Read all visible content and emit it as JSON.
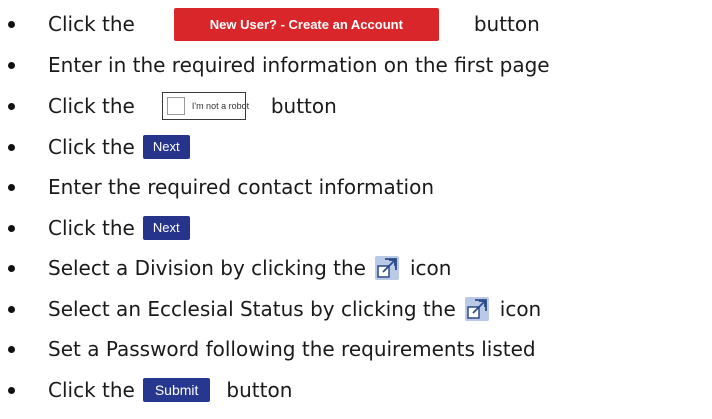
{
  "steps": [
    {
      "before": "Click the",
      "button": "New User? - Create an Account",
      "after": "button"
    },
    {
      "text": "Enter in the required information on the first page"
    },
    {
      "before": "Click the",
      "captcha_label": "I'm not a robot",
      "after": "button"
    },
    {
      "before": "Click the",
      "button": "Next"
    },
    {
      "text": "Enter the required contact information"
    },
    {
      "before": "Click the",
      "button": "Next"
    },
    {
      "before": "Select a Division by clicking the",
      "icon": "lookup-popup-icon",
      "after": "icon"
    },
    {
      "before": "Select an Ecclesial Status by clicking the",
      "icon": "lookup-popup-icon",
      "after": "icon"
    },
    {
      "text": "Set a Password following the requirements listed"
    },
    {
      "before": "Click the",
      "button": "Submit",
      "after": "button"
    }
  ],
  "colors": {
    "create_button": "#d9262b",
    "navy_button": "#26348c",
    "icon_bg": "#b9c9e6",
    "icon_stroke": "#2b4a8a"
  }
}
